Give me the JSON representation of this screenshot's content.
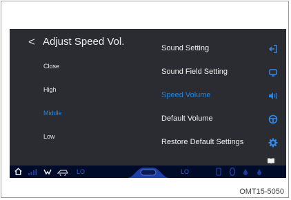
{
  "screen": {
    "title": "Adjust Speed Vol.",
    "back_glyph": "<",
    "options": [
      {
        "label": "Close",
        "active": false
      },
      {
        "label": "High",
        "active": false
      },
      {
        "label": "Middle",
        "active": true
      },
      {
        "label": "Low",
        "active": false
      }
    ],
    "menu": [
      {
        "label": "Sound Setting",
        "icon": "exit-arrow-icon",
        "active": false
      },
      {
        "label": "Sound Field Setting",
        "icon": "speaker-field-icon",
        "active": false
      },
      {
        "label": "Speed Volume",
        "icon": "speaker-wave-icon",
        "active": true
      },
      {
        "label": "Default Volume",
        "icon": "steering-wheel-icon",
        "active": false
      },
      {
        "label": "Restore Default Settings",
        "icon": "gear-icon",
        "active": false
      }
    ],
    "manual_icon": "book-icon"
  },
  "status_bar": {
    "left_temp": "LO",
    "right_temp": "LO"
  },
  "caption": "OMT15-5050",
  "colors": {
    "screen_bg": "#2a2c32",
    "accent": "#1e88e5",
    "status_bg": "#000b2a"
  }
}
